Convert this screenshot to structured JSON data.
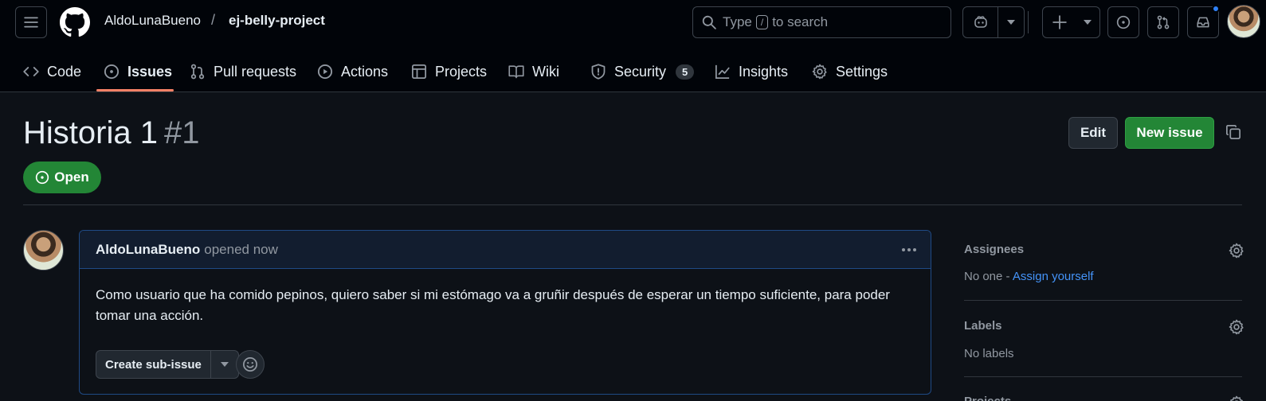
{
  "header": {
    "owner": "AldoLunaBueno",
    "separator": "/",
    "repo": "ej-belly-project",
    "search": {
      "before": "Type",
      "key": "/",
      "after": "to search"
    },
    "icons": [
      "hamburger-icon",
      "github-logo",
      "search-icon",
      "copilot-icon",
      "plus-icon",
      "issue-opened-icon",
      "pull-request-icon",
      "inbox-icon"
    ],
    "notification_color": "#2f81f7"
  },
  "nav": {
    "tabs": [
      {
        "label": "Code",
        "icon": "code-icon"
      },
      {
        "label": "Issues",
        "icon": "issue-opened-icon",
        "active": true
      },
      {
        "label": "Pull requests",
        "icon": "pull-request-icon"
      },
      {
        "label": "Actions",
        "icon": "play-icon"
      },
      {
        "label": "Projects",
        "icon": "table-icon"
      },
      {
        "label": "Wiki",
        "icon": "book-icon"
      },
      {
        "label": "Security",
        "icon": "shield-icon",
        "count": "5"
      },
      {
        "label": "Insights",
        "icon": "graph-icon"
      },
      {
        "label": "Settings",
        "icon": "gear-icon"
      }
    ],
    "active_color": "#f78166"
  },
  "issue": {
    "title": "Historia 1",
    "number": "#1",
    "state": "Open",
    "state_color": "#238636",
    "edit_label": "Edit",
    "new_issue_label": "New issue"
  },
  "comment": {
    "author": "AldoLunaBueno",
    "action": "opened now",
    "body": "Como usuario que ha comido pepinos, quiero saber si mi estómago va a gruñir después de esperar un tiempo suficiente, para poder tomar una acción.",
    "create_subissue_label": "Create sub-issue",
    "border_color": "#1f4a85"
  },
  "sidebar": {
    "assignees": {
      "label": "Assignees",
      "value": "No one -",
      "link": "Assign yourself"
    },
    "labels": {
      "label": "Labels",
      "value": "No labels"
    },
    "projects": {
      "label": "Projects"
    }
  }
}
